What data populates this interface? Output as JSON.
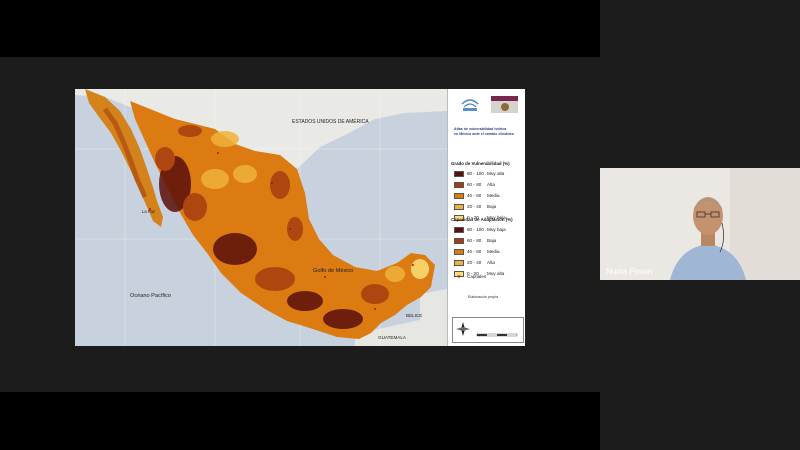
{
  "meeting": {
    "participant_name": "Numa Pavon"
  },
  "slide": {
    "header_line1": "Atlas de vulnerabilidad hídrica",
    "header_line2": "en México ante el cambio climático",
    "vulnerability_title": "Grado de Vulnerabilidad (%)",
    "vulnerability_classes": [
      {
        "range": "80 - 100",
        "label": "Muy alta",
        "color": "#5a0f0a"
      },
      {
        "range": "60 - 80",
        "label": "Alta",
        "color": "#a73d10"
      },
      {
        "range": "40 - 60",
        "label": "Media",
        "color": "#db7b12"
      },
      {
        "range": "20 - 40",
        "label": "Baja",
        "color": "#f0b33a"
      },
      {
        "range": "0 - 20",
        "label": "Muy baja",
        "color": "#fbe07a"
      }
    ],
    "adaptation_title": "Capacidad de Adaptación (%)",
    "adaptation_classes": [
      {
        "range": "80 - 100",
        "label": "Muy baja",
        "color": "#5a0f0a"
      },
      {
        "range": "60 - 80",
        "label": "Baja",
        "color": "#a73d10"
      },
      {
        "range": "40 - 60",
        "label": "Media",
        "color": "#db7b12"
      },
      {
        "range": "20 - 40",
        "label": "Alta",
        "color": "#f0b33a"
      },
      {
        "range": "0 - 20",
        "label": "Muy alta",
        "color": "#fbe07a"
      }
    ],
    "capitals_label": "Capitales",
    "credit": "Elaboración propia",
    "map_labels": {
      "usa": "ESTADOS UNIDOS DE AMÉRICA",
      "gulf": "Golfo de México",
      "pacific": "Océano Pacífico",
      "belize": "BELICE",
      "guatemala": "GUATEMALA",
      "la_paz": "La Paz"
    }
  }
}
